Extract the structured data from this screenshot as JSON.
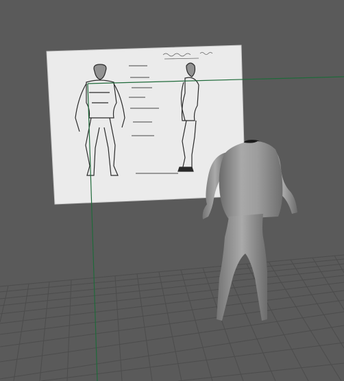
{
  "viewport": {
    "background_color": "#5a5a5a",
    "grid_line_color": "#4a4a4a",
    "axis_color": "#1f6a3a",
    "model_color": "#a5a5a5"
  },
  "image_plane": {
    "header_annotation_left": "",
    "header_annotation_right": ""
  },
  "model": {
    "name": "",
    "material": "default-lambert"
  }
}
